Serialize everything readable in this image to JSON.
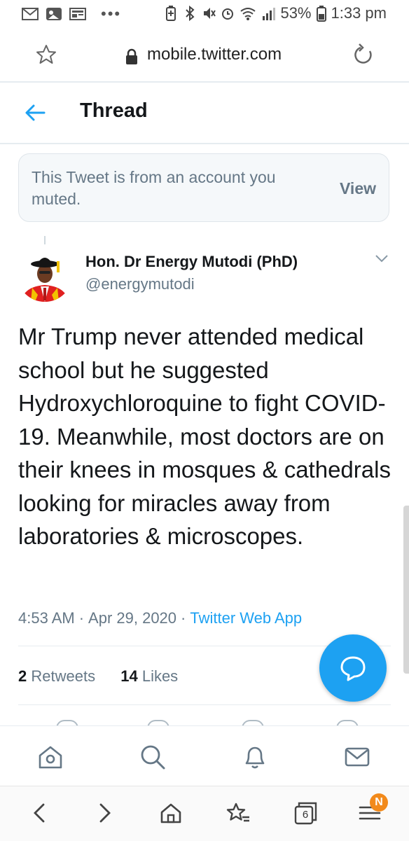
{
  "status_bar": {
    "dots": "•••",
    "battery": "53%",
    "time": "1:33 pm"
  },
  "browser": {
    "url": "mobile.twitter.com",
    "tab_count": "6",
    "menu_badge": "N"
  },
  "header": {
    "title": "Thread"
  },
  "muted_notice": {
    "text": "This Tweet is from an account you muted.",
    "view_label": "View"
  },
  "tweet": {
    "author_name": "Hon. Dr Energy Mutodi (PhD)",
    "author_handle": "@energymutodi",
    "text": "Mr Trump never attended medical school but he suggested Hydroxychloroquine to fight COVID-19. Meanwhile, most doctors are on their knees in mosques & cathedrals looking for miracles away from laboratories & microscopes.",
    "time": "4:53 AM",
    "date": "Apr 29, 2020",
    "source": "Twitter Web App",
    "separator": "·",
    "retweet_count": "2",
    "retweet_label": "Retweets",
    "like_count": "14",
    "like_label": "Likes"
  },
  "colors": {
    "accent": "#1da1f2",
    "secondary_text": "#657786",
    "badge": "#f28a1b"
  },
  "icons": {
    "header": "back-arrow-icon",
    "tweet": "chevron-down-icon",
    "fab": "reply-bubble-icon",
    "twitter_nav": [
      "home-icon",
      "search-icon",
      "bell-icon",
      "mail-icon"
    ],
    "browser_nav": [
      "back-icon",
      "forward-icon",
      "home-icon",
      "bookmarks-icon",
      "tabs-icon",
      "menu-icon"
    ]
  }
}
